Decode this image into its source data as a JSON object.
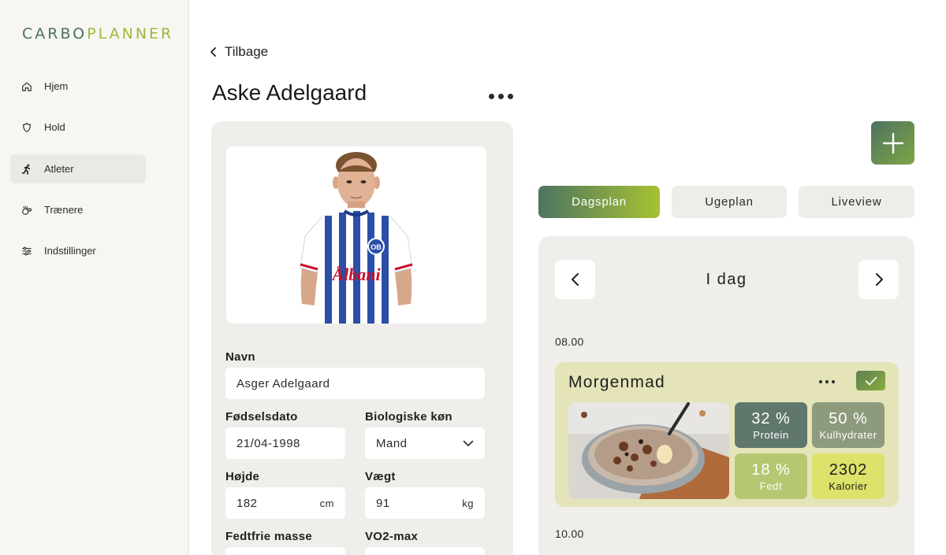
{
  "app": {
    "logo_part1": "CARBO",
    "logo_part2": "PLANNER"
  },
  "sidebar": {
    "items": [
      {
        "label": "Hjem",
        "icon": "home-icon"
      },
      {
        "label": "Hold",
        "icon": "shield-icon"
      },
      {
        "label": "Atleter",
        "icon": "runner-icon",
        "active": true
      },
      {
        "label": "Trænere",
        "icon": "whistle-icon"
      },
      {
        "label": "Indstillinger",
        "icon": "sliders-icon"
      }
    ]
  },
  "header": {
    "back_label": "Tilbage",
    "title": "Aske Adelgaard"
  },
  "profile": {
    "name_label": "Navn",
    "name_value": "Asger Adelgaard",
    "birth_label": "Fødselsdato",
    "birth_value": "21/04-1998",
    "sex_label": "Biologiske køn",
    "sex_value": "Mand",
    "height_label": "Højde",
    "height_value": "182",
    "height_unit": "cm",
    "weight_label": "Vægt",
    "weight_value": "91",
    "weight_unit": "kg",
    "ffm_label": "Fedtfrie masse",
    "vo2_label": "VO2-max",
    "jersey_sponsor": "Ålbani",
    "jersey_badge": "OB"
  },
  "tabs": [
    {
      "label": "Dagsplan",
      "active": true
    },
    {
      "label": "Ugeplan"
    },
    {
      "label": "Liveview"
    }
  ],
  "day": {
    "title": "I dag",
    "times": [
      "08.00",
      "10.00"
    ],
    "meal": {
      "title": "Morgenmad",
      "stats": [
        {
          "value": "32 %",
          "label": "Protein",
          "color": "#60776c"
        },
        {
          "value": "50 %",
          "label": "Kulhydrater",
          "color": "#8d9a7c"
        },
        {
          "value": "18 %",
          "label": "Fedt",
          "color": "#b6c772"
        },
        {
          "value": "2302",
          "label": "Kalorier",
          "color": "#dde26a"
        }
      ]
    }
  },
  "colors": {
    "accent_dark": "#4e7460",
    "accent_light": "#a6c233",
    "panel": "#f0eeea",
    "meal_card": "#e5e4b8"
  }
}
